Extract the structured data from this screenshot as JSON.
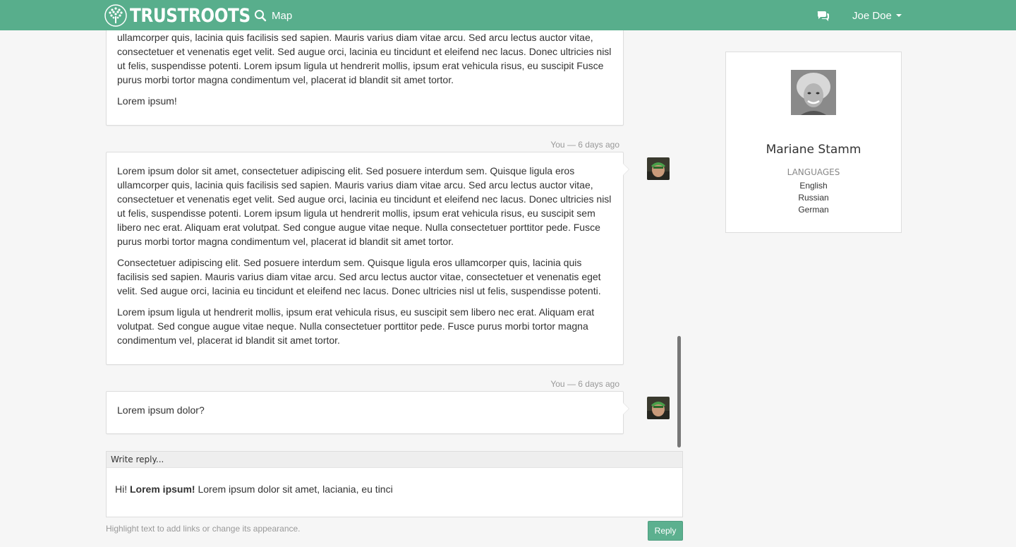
{
  "navbar": {
    "brand": "TRUSTROOTS",
    "map_label": "Map",
    "user_name": "Joe Doe",
    "bg_color": "#58ae8c"
  },
  "messages": [
    {
      "paragraphs": [
        "ullamcorper quis, lacinia quis facilisis sed sapien. Mauris varius diam vitae arcu. Sed arcu lectus auctor vitae, consectetuer et venenatis eget velit. Sed augue orci, lacinia eu tincidunt et eleifend nec lacus. Donec ultricies nisl ut felis, suspendisse potenti. Lorem ipsum ligula ut hendrerit mollis, ipsum erat vehicula risus, eu suscipit Fusce purus morbi tortor magna condimentum vel, placerat id blandit sit amet tortor.",
        "Lorem ipsum!"
      ]
    },
    {
      "meta": "You — 6 days ago",
      "paragraphs": [
        "Lorem ipsum dolor sit amet, consectetuer adipiscing elit. Sed posuere interdum sem. Quisque ligula eros ullamcorper quis, lacinia quis facilisis sed sapien. Mauris varius diam vitae arcu. Sed arcu lectus auctor vitae, consectetuer et venenatis eget velit. Sed augue orci, lacinia eu tincidunt et eleifend nec lacus. Donec ultricies nisl ut felis, suspendisse potenti. Lorem ipsum ligula ut hendrerit mollis, ipsum erat vehicula risus, eu suscipit sem libero nec erat. Aliquam erat volutpat. Sed congue augue vitae neque. Nulla consectetuer porttitor pede. Fusce purus morbi tortor magna condimentum vel, placerat id blandit sit amet tortor.",
        "Consectetuer adipiscing elit. Sed posuere interdum sem. Quisque ligula eros ullamcorper quis, lacinia quis facilisis sed sapien. Mauris varius diam vitae arcu. Sed arcu lectus auctor vitae, consectetuer et venenatis eget velit. Sed augue orci, lacinia eu tincidunt et eleifend nec lacus. Donec ultricies nisl ut felis, suspendisse potenti.",
        "Lorem ipsum ligula ut hendrerit mollis, ipsum erat vehicula risus, eu suscipit sem libero nec erat. Aliquam erat volutpat. Sed congue augue vitae neque. Nulla consectetuer porttitor pede. Fusce purus morbi tortor magna condimentum vel, placerat id blandit sit amet tortor."
      ]
    },
    {
      "meta": "You — 6 days ago",
      "paragraphs": [
        "Lorem ipsum dolor?"
      ]
    }
  ],
  "reply": {
    "header": "Write reply...",
    "greeting": "Hi! ",
    "bold": "Lorem ipsum!",
    "rest": " Lorem ipsum dolor sit amet, laciania, eu tinci",
    "hint": "Highlight text to add links or change its appearance.",
    "button_label": "Reply",
    "button_color": "#5cb08f"
  },
  "profile": {
    "name": "Mariane Stamm",
    "languages_title": "Languages",
    "languages": [
      "English",
      "Russian",
      "German"
    ]
  }
}
